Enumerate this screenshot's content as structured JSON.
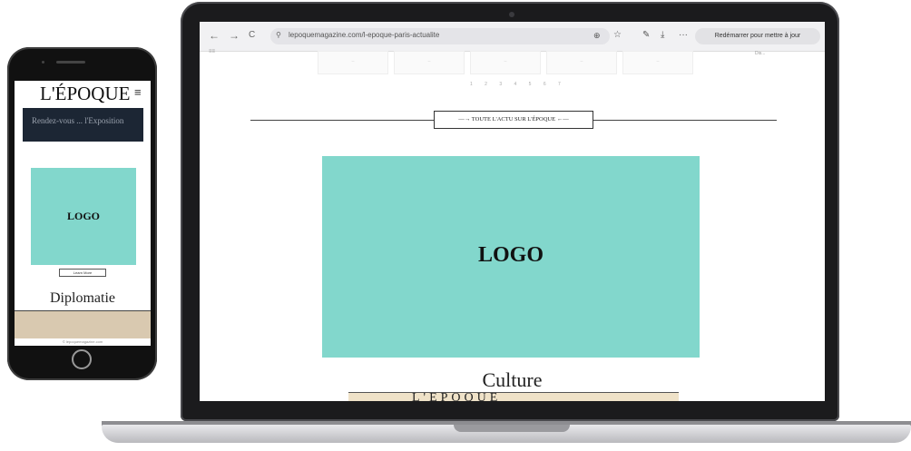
{
  "laptop": {
    "browser": {
      "nav_back": "←",
      "nav_forward": "→",
      "nav_reload": "C",
      "url_icon": "⚲",
      "url": "lepoquemagazine.com/l-epoque-paris-actualite",
      "zoom_icon": "⊕",
      "star_icon": "☆",
      "ext_icon": "✎",
      "download_icon": "⤓",
      "more_icon": "···",
      "update_button": "Redémarrer pour mettre à jour"
    },
    "page": {
      "left_mark": "≡≡",
      "right_mark": "Dis...",
      "cards": [
        "...",
        "...",
        "...",
        "...",
        "..."
      ],
      "pagination": "1 2 3 4 5 6 7",
      "section_badge": "—→ TOUTE L'ACTU SUR L'ÉPOQUE ←—",
      "logo_text": "LOGO",
      "section_title": "Culture",
      "section_image_text": "L'EPOQUE"
    }
  },
  "phone": {
    "site_logo": "L'ÉPOQUE",
    "menu_icon": "≡",
    "banner_text": "Rendez-vous ... l'Exposition",
    "logo_text": "LOGO",
    "learn_more": "Learn More",
    "section_title": "Diplomatie",
    "footer_text": "© lepoquemagazine.com"
  },
  "colors": {
    "logo_placeholder": "#82d7cc",
    "device_frame": "#1b1b1d",
    "laptop_base": "#c9c9cc"
  }
}
